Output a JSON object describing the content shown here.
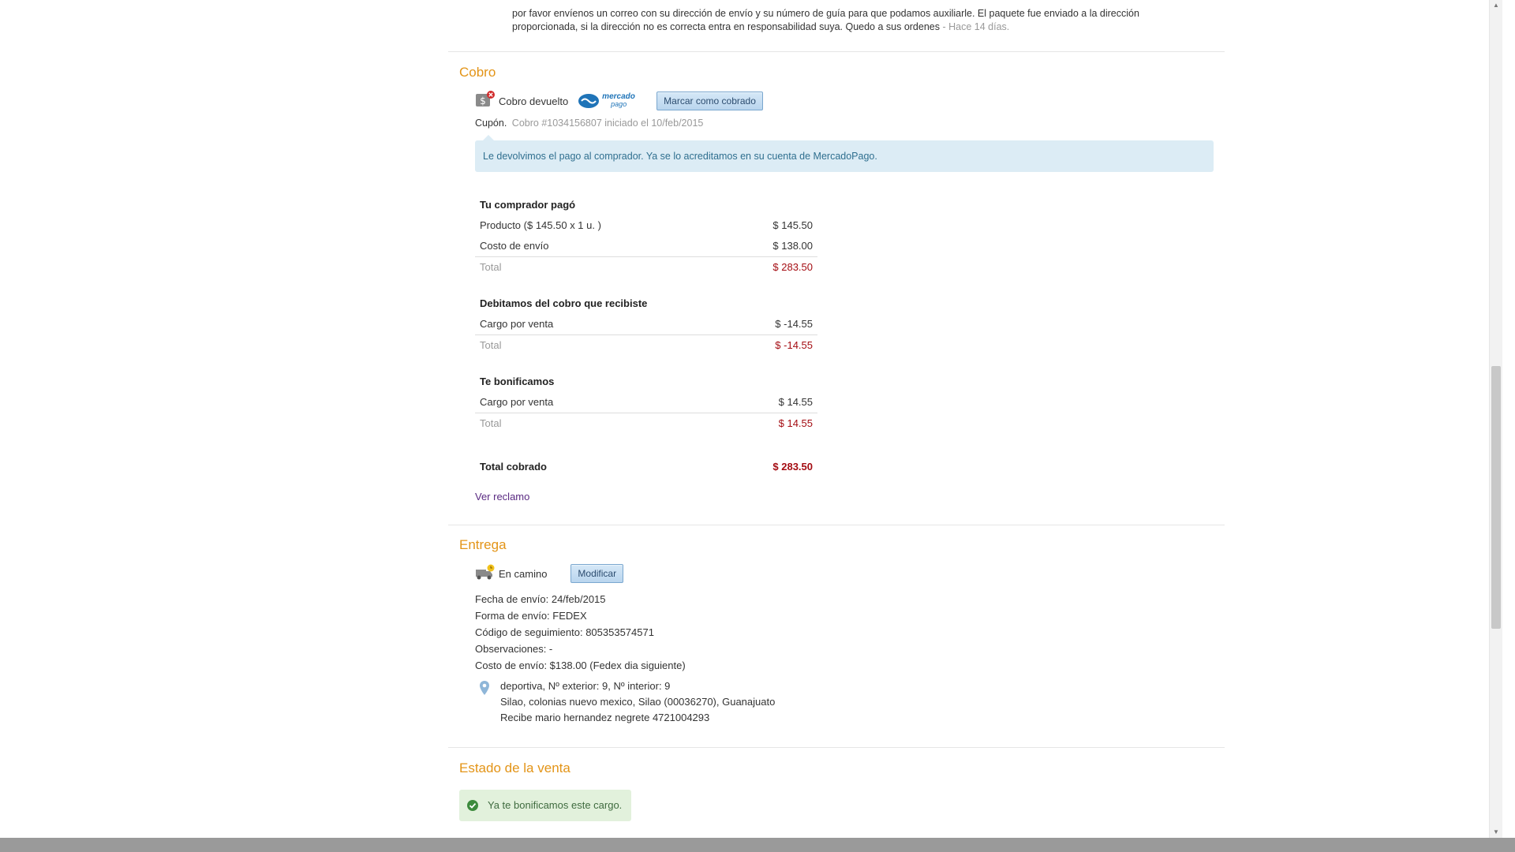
{
  "comment": {
    "line1": "por favor envíenos un correo con su dirección de envío y su número de guía para que podamos auxiliarle. El paquete fue enviado a la dirección",
    "line2": "proporcionada, si la dirección no es correcta entra en responsabilidad suya. Quedo a sus ordenes",
    "ago": " - Hace 14 días."
  },
  "cobro": {
    "title": "Cobro",
    "status": "Cobro devuelto",
    "provider_line1": "mercado",
    "provider_line2": "pago",
    "mark_button": "Marcar como cobrado",
    "coupon_label": "Cupón.",
    "coupon_text": "Cobro #1034156807 iniciado el 10/feb/2015",
    "info_message": "Le devolvimos el pago al comprador. Ya se lo acreditamos en su cuenta de MercadoPago.",
    "buyer_paid": {
      "heading": "Tu comprador pagó",
      "rows": [
        {
          "label": "Producto ($ 145.50 x 1 u. )",
          "amount": "$ 145.50"
        },
        {
          "label": "Costo de envío",
          "amount": "$ 138.00"
        }
      ],
      "total_label": "Total",
      "total_amount": "$ 283.50"
    },
    "debited": {
      "heading": "Debitamos del cobro que recibiste",
      "rows": [
        {
          "label": "Cargo por venta",
          "amount": "$ -14.55"
        }
      ],
      "total_label": "Total",
      "total_amount": "$ -14.55"
    },
    "bonus": {
      "heading": "Te bonificamos",
      "rows": [
        {
          "label": "Cargo por venta",
          "amount": "$ 14.55"
        }
      ],
      "total_label": "Total",
      "total_amount": "$ 14.55"
    },
    "grand_total_label": "Total cobrado",
    "grand_total_amount": "$ 283.50",
    "claim_link": "Ver reclamo"
  },
  "entrega": {
    "title": "Entrega",
    "status": "En camino",
    "modify_button": "Modificar",
    "details": [
      "Fecha de envío: 24/feb/2015",
      "Forma de envío: FEDEX",
      "Código de seguimiento: 805353574571",
      "Observaciones: -",
      "Costo de envío: $138.00 (Fedex dia siguiente)"
    ],
    "address": [
      "deportiva, Nº exterior: 9, Nº interior: 9",
      "Silao, colonias nuevo mexico, Silao (00036270), Guanajuato",
      "Recibe mario hernandez negrete 4721004293"
    ]
  },
  "estado": {
    "title": "Estado de la venta",
    "message": "Ya te bonificamos este cargo."
  },
  "colors": {
    "section_title": "#e39417",
    "amount_red": "#a40c12",
    "info_bg": "#dcecf5",
    "success_bg": "#e2f1dc",
    "link": "#5a2a82"
  }
}
